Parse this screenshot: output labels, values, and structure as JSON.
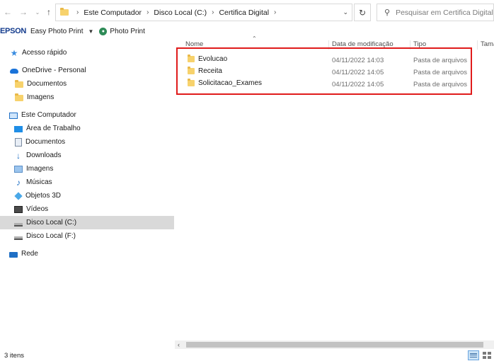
{
  "address": {
    "crumbs": [
      "Este Computador",
      "Disco Local (C:)",
      "Certifica Digital"
    ],
    "search_placeholder": "Pesquisar em Certifica Digital"
  },
  "epson": {
    "logo": "EPSON",
    "app_label": "Easy Photo Print",
    "photo_label": "Photo Print"
  },
  "nav": {
    "items": [
      {
        "label": "Acesso rápido",
        "icon": "star-icon"
      },
      {
        "label": "OneDrive - Personal",
        "icon": "cloud-icon"
      },
      {
        "label": "Documentos",
        "icon": "folder-icon"
      },
      {
        "label": "Imagens",
        "icon": "folder-icon"
      },
      {
        "label": "Este Computador",
        "icon": "computer-icon"
      },
      {
        "label": "Área de Trabalho",
        "icon": "desktop-icon"
      },
      {
        "label": "Documentos",
        "icon": "documents-icon"
      },
      {
        "label": "Downloads",
        "icon": "download-icon"
      },
      {
        "label": "Imagens",
        "icon": "pictures-icon"
      },
      {
        "label": "Músicas",
        "icon": "music-icon"
      },
      {
        "label": "Objetos 3D",
        "icon": "3d-objects-icon"
      },
      {
        "label": "Vídeos",
        "icon": "videos-icon"
      },
      {
        "label": "Disco Local (C:)",
        "icon": "drive-icon"
      },
      {
        "label": "Disco Local (F:)",
        "icon": "drive-icon"
      },
      {
        "label": "Rede",
        "icon": "network-icon"
      }
    ],
    "selected": "Disco Local (C:)"
  },
  "columns": {
    "name": "Nome",
    "date": "Data de modificação",
    "type": "Tipo",
    "size": "Tama"
  },
  "files": [
    {
      "name": "Evolucao",
      "date": "04/11/2022 14:03",
      "type": "Pasta de arquivos"
    },
    {
      "name": "Receita",
      "date": "04/11/2022 14:05",
      "type": "Pasta de arquivos"
    },
    {
      "name": "Solicitacao_Exames",
      "date": "04/11/2022 14:05",
      "type": "Pasta de arquivos"
    }
  ],
  "status": {
    "count": "3 itens"
  },
  "colors": {
    "highlight": "#e01b1b",
    "selected_bg": "#d9d9d9",
    "folder": "#f7d26c"
  }
}
